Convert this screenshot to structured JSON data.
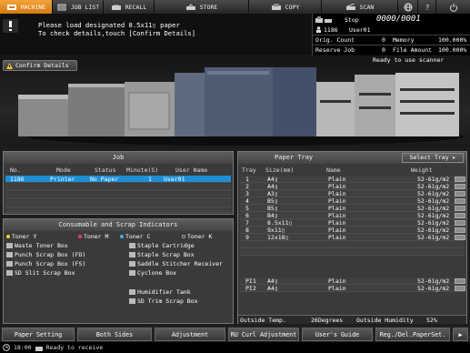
{
  "tabs": [
    {
      "label": "MACHINE",
      "icon": "printer-icon",
      "active": true
    },
    {
      "label": "JOB LIST",
      "icon": "joblist-icon",
      "active": false
    },
    {
      "label": "RECALL",
      "icon": "recall-icon",
      "active": false
    },
    {
      "label": "STORE",
      "icon": "store-icon",
      "active": false
    },
    {
      "label": "COPY",
      "icon": "copy-icon",
      "active": false
    },
    {
      "label": "SCAN",
      "icon": "scan-icon",
      "active": false
    }
  ],
  "message": {
    "line1": "Please load designated  8.5x11▯  paper",
    "line2": "To check details,touch [Confirm Details]"
  },
  "status": {
    "state": "Stop",
    "counter": "0000/0001",
    "job_id": "1186",
    "user": "User01",
    "orig_count_label": "Orig. Count",
    "orig_count": "0",
    "memory_label": "Memory",
    "memory": "100.000%",
    "reserve_job_label": "Reserve Job",
    "reserve_job": "0",
    "file_amount_label": "File Amount",
    "file_amount": "100.000%"
  },
  "confirm_details": "Confirm Details",
  "scanner_status": "Ready to use scanner",
  "job_panel": {
    "title": "Job",
    "headers": [
      "No.",
      "Mode",
      "Status",
      "Minute(S)",
      "User Name"
    ],
    "rows": [
      {
        "no": "1186",
        "mode": "Printer",
        "status": "No Paper",
        "minutes": "1",
        "user": "User01"
      }
    ]
  },
  "consumables": {
    "title": "Consumable and Scrap Indicators",
    "left": [
      "Toner Y",
      "Waste Toner Box",
      "Punch Scrap Box (FD)",
      "Punch Scrap Box (FS)",
      "SD Slit Scrap Box"
    ],
    "mid_toner": "Toner M",
    "right": [
      "Toner C",
      "Staple Cartridge",
      "Staple Scrap Box",
      "Saddle Stitcher Receiver",
      "Cyclone Box"
    ],
    "right_toner": "Toner K",
    "bottom": [
      "Humidifier Tank",
      "SD Trim Scrap Box"
    ]
  },
  "paper_tray": {
    "title": "Paper Tray",
    "select_label": "Select Tray",
    "headers": [
      "Tray",
      "Size(mm)",
      "Name",
      "Weight"
    ],
    "rows": [
      {
        "tray": "1",
        "size": "A4▯",
        "name": "Plain",
        "weight": "52-61g/m2"
      },
      {
        "tray": "2",
        "size": "A4▯",
        "name": "Plain",
        "weight": "52-61g/m2"
      },
      {
        "tray": "3",
        "size": "A3▯",
        "name": "Plain",
        "weight": "52-61g/m2"
      },
      {
        "tray": "4",
        "size": "B5▯",
        "name": "Plain",
        "weight": "52-61g/m2"
      },
      {
        "tray": "5",
        "size": "B5▯",
        "name": "Plain",
        "weight": "52-61g/m2"
      },
      {
        "tray": "6",
        "size": "B4▯",
        "name": "Plain",
        "weight": "52-61g/m2"
      },
      {
        "tray": "7",
        "size": "8.5x11▯",
        "name": "Plain",
        "weight": "52-61g/m2"
      },
      {
        "tray": "8",
        "size": "9x11▯",
        "name": "Plain",
        "weight": "52-61g/m2"
      },
      {
        "tray": "9",
        "size": "12x18▯",
        "name": "Plain",
        "weight": "52-61g/m2"
      }
    ],
    "pi_rows": [
      {
        "tray": "PI1",
        "size": "A4▯",
        "name": "Plain",
        "weight": "52-61g/m2"
      },
      {
        "tray": "PI2",
        "size": "A4▯",
        "name": "Plain",
        "weight": "52-61g/m2"
      }
    ],
    "outside_temp_label": "Outside Temp.",
    "outside_temp": "26Degrees",
    "outside_humidity_label": "Outside Humidity",
    "outside_humidity": "52%"
  },
  "bottom_buttons": [
    "Paper Setting",
    "Both Sides",
    "Adjustment",
    "RU Curl Adjustment",
    "User's Guide",
    "Reg./Del.PaperSet."
  ],
  "statusline": {
    "time": "18:00",
    "text": "Ready to receive"
  }
}
